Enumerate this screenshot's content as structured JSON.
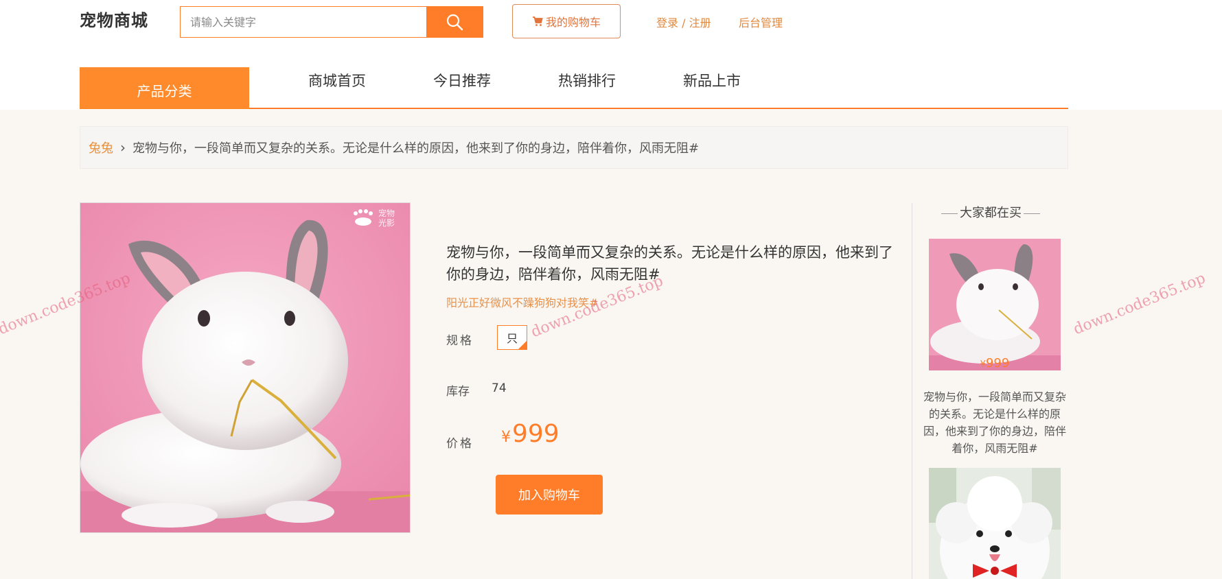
{
  "header": {
    "logo": "宠物商城",
    "search_placeholder": "请输入关键字",
    "cart_label": "我的购物车",
    "auth_link": "登录 / 注册",
    "admin_link": "后台管理"
  },
  "nav": {
    "category": "产品分类",
    "items": [
      "商城首页",
      "今日推荐",
      "热销排行",
      "新品上市"
    ]
  },
  "breadcrumb": {
    "category": "兔兔",
    "title": "宠物与你，一段简单而又复杂的关系。无论是什么样的原因，他来到了你的身边，陪伴着你，风雨无阻#"
  },
  "product": {
    "title": "宠物与你，一段简单而又复杂的关系。无论是什么样的原因，他来到了你的身边，陪伴着你，风雨无阻#",
    "subtitle": "阳光正好微风不躁狗狗对我笑#",
    "spec_label": "规格",
    "spec_value": "只",
    "stock_label": "库存",
    "stock_value": "74",
    "price_label": "价格",
    "currency": "¥",
    "price": "999",
    "add_cart": "加入购物车",
    "image_watermark": "宠物光影"
  },
  "sidebar": {
    "heading": "大家都在买",
    "items": [
      {
        "price_currency": "¥",
        "price": "999",
        "caption": "宠物与你，一段简单而又复杂的关系。无论是什么样的原因，他来到了你的身边，陪伴着你，风雨无阻#"
      },
      {
        "caption": ""
      }
    ]
  },
  "watermarks": [
    "down.code365.top",
    "down.code365.top",
    "down.code365.top"
  ],
  "colors": {
    "accent": "#ff7d29",
    "link": "#e0883f",
    "background": "#faf7f2"
  }
}
